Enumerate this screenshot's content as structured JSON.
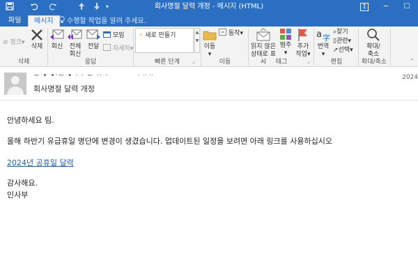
{
  "titlebar": {
    "title": "회사명절 달력 개정 - 메시지 (HTML)",
    "icons": {
      "save": "save-icon",
      "undo": "undo-icon",
      "redo": "redo-icon",
      "up": "up-arrow-icon",
      "down": "down-arrow-icon",
      "more": "qat-more-icon"
    },
    "window_buttons": {
      "restore_ribbon": "↥",
      "minimize": "─",
      "maximize": "☐"
    },
    "bg_color": "#2b6fc2"
  },
  "tabs": [
    {
      "label": "파일"
    },
    {
      "label": "메시지",
      "active": true
    }
  ],
  "tell_me": {
    "text": "수행할 작업을 알려 주세요."
  },
  "ribbon": {
    "delete_group": {
      "label": "삭제",
      "junk": "정크",
      "delete": "삭제"
    },
    "respond_group": {
      "label": "응답",
      "reply": "회신",
      "reply_all_line1": "전체",
      "reply_all_line2": "회신",
      "forward": "전달",
      "meeting": "모임",
      "more": "자세히"
    },
    "quick_steps": {
      "label": "빠른 단계",
      "new": "새로 만들기"
    },
    "move_group": {
      "label": "이동",
      "move": "이동",
      "actions": "동작"
    },
    "tags_group": {
      "label": "태그",
      "unread_line1": "읽지 않은",
      "unread_line2": "상태로 표시",
      "categorize": "범주",
      "follow_line1": "추가",
      "follow_line2": "작업"
    },
    "editing_group": {
      "label": "편집",
      "translate": "번역",
      "find": "찾기",
      "related": "관련",
      "select": "선택"
    },
    "zoom_group": {
      "label": "확대/축소",
      "zoom_line1": "확대/",
      "zoom_line2": "축소"
    }
  },
  "message": {
    "sender": "~ • •·~ • · · ~ ·· ·",
    "recipient": "· ·· ··",
    "date": "2024",
    "subject": "회사명절 달력 개정",
    "body": {
      "greeting": "안녕하세요 팀.",
      "paragraph": "올해 하반기 유급휴일 명단에 변경이 생겼습니다. 업데이트된 일정을 보려면 아래 링크를 사용하십시오",
      "link_text": "2024년 공휴일 달력",
      "closing": "감사해요.",
      "signature": "인사부"
    }
  }
}
